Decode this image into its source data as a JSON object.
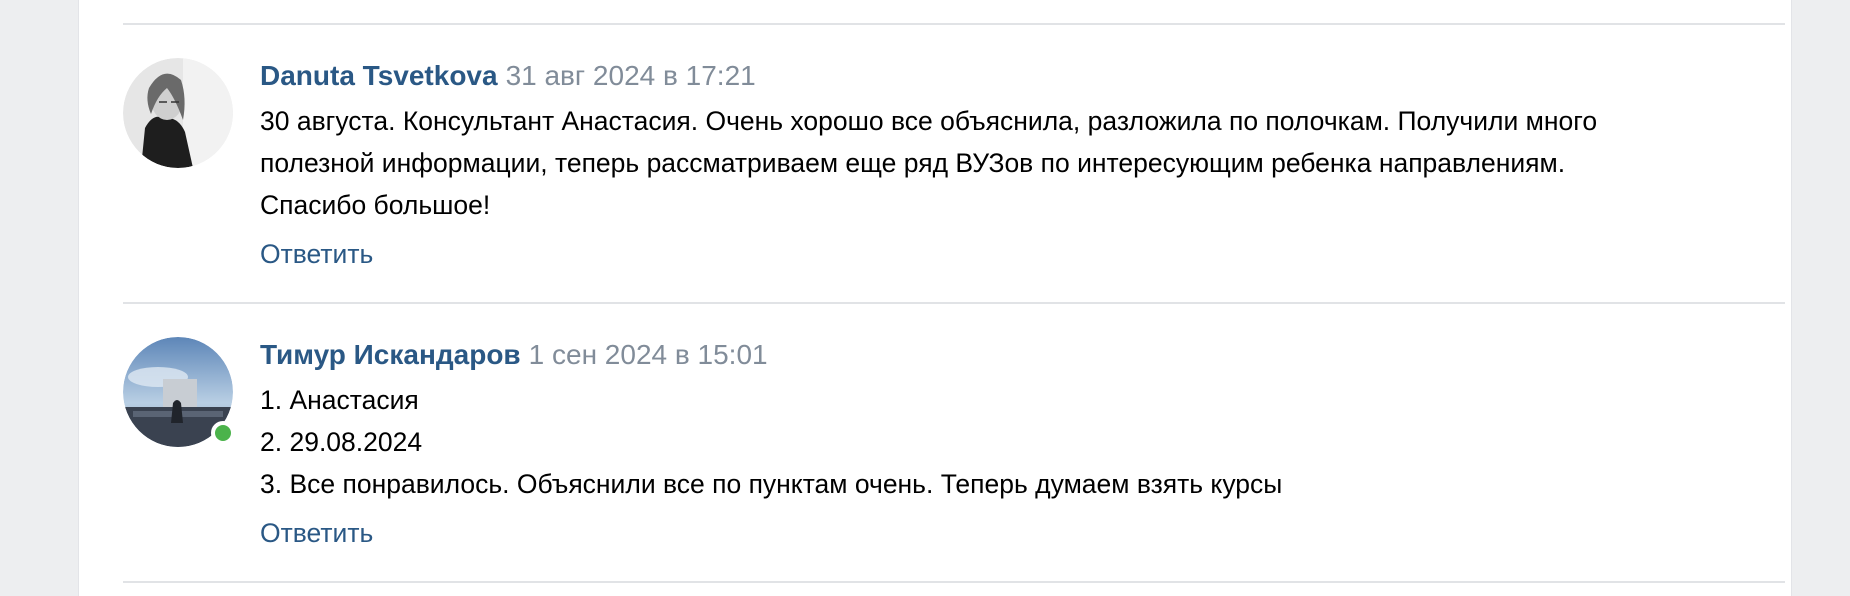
{
  "comments": [
    {
      "author": "Danuta Tsvetkova",
      "date": "31 авг 2024 в 17:21",
      "text_lines": [
        "30 августа. Консультант Анастасия. Очень хорошо все объяснила, разложила по полочкам. Получили много",
        "полезной информации, теперь рассматриваем еще ряд ВУЗов по интересующим ребенка направлениям.",
        "Спасибо большое!"
      ],
      "reply_label": "Ответить",
      "online": false
    },
    {
      "author": "Тимур Искандаров",
      "date": "1 сен 2024 в 15:01",
      "text_lines": [
        "1. Анастасия",
        "2. 29.08.2024",
        "3. Все понравилось. Объяснили все по пунктам очень. Теперь думаем взять курсы"
      ],
      "reply_label": "Ответить",
      "online": true
    }
  ],
  "colors": {
    "link": "#2a5885",
    "meta": "#818c99",
    "online": "#4bb34b",
    "background": "#edeef0"
  }
}
